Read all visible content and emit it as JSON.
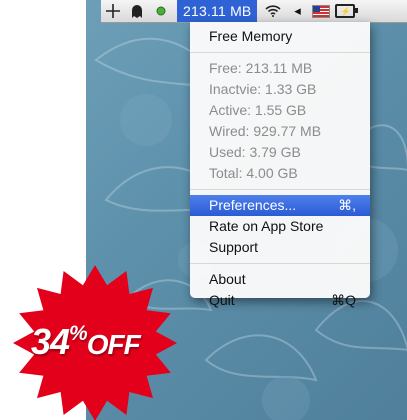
{
  "menubar": {
    "memory_readout": "213.11 MB",
    "icons": [
      "move-cross-icon",
      "ghost-icon",
      "status-dot-icon",
      "wifi-icon",
      "volume-icon",
      "us-flag-icon",
      "battery-icon"
    ],
    "volume_glyph": "◂",
    "battery_glyph": "⚡"
  },
  "menu": {
    "title": "Free Memory",
    "stats": [
      "Free: 213.11 MB",
      "Inactvie: 1.33 GB",
      "Active: 1.55 GB",
      "Wired: 929.77 MB",
      "Used: 3.79 GB",
      "Total: 4.00 GB"
    ],
    "preferences": {
      "label": "Preferences...",
      "shortcut": "⌘,"
    },
    "rate": "Rate on App Store",
    "support": "Support",
    "about": "About",
    "quit": {
      "label": "Quit",
      "shortcut": "⌘Q"
    }
  },
  "badge": {
    "discount": "34",
    "percent": "%",
    "off": "OFF",
    "color": "#e3001b"
  },
  "colors": {
    "highlight": "#2f62d4",
    "desktop": "#5d90ab"
  }
}
